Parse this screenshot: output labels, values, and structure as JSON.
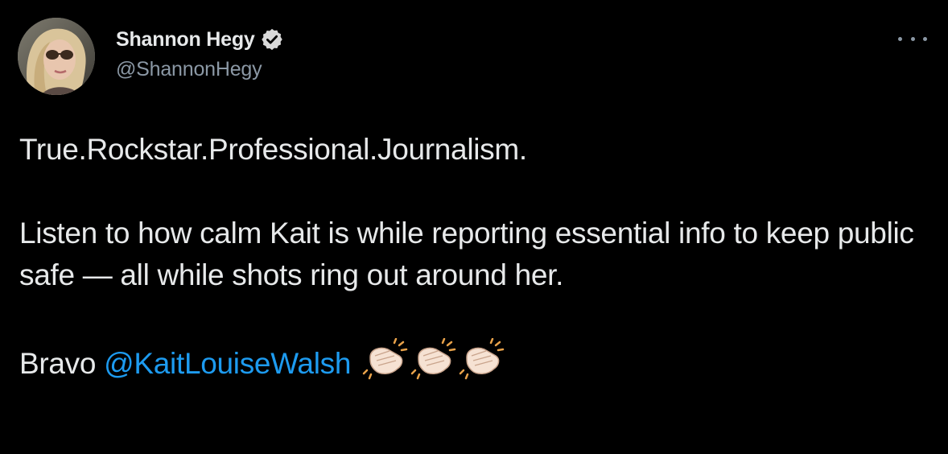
{
  "author": {
    "display_name": "Shannon Hegy",
    "handle": "@ShannonHegy",
    "verified": true,
    "verified_color": "#d9d9d9"
  },
  "tweet": {
    "line1": "True.Rockstar.Professional.Journalism.",
    "paragraph2": "Listen to how calm Kait is while reporting essential info to keep public safe — all while shots ring out around her.",
    "bravo_text": "Bravo",
    "mention": "@KaitLouiseWalsh",
    "emoji": [
      "clapping-hands",
      "clapping-hands",
      "clapping-hands"
    ]
  },
  "icons": {
    "more": "more-horizontal-icon",
    "verified": "verified-badge-icon"
  },
  "colors": {
    "background": "#000000",
    "text": "#e7e9ea",
    "secondary": "#8b98a5",
    "link": "#1d9bf0"
  }
}
